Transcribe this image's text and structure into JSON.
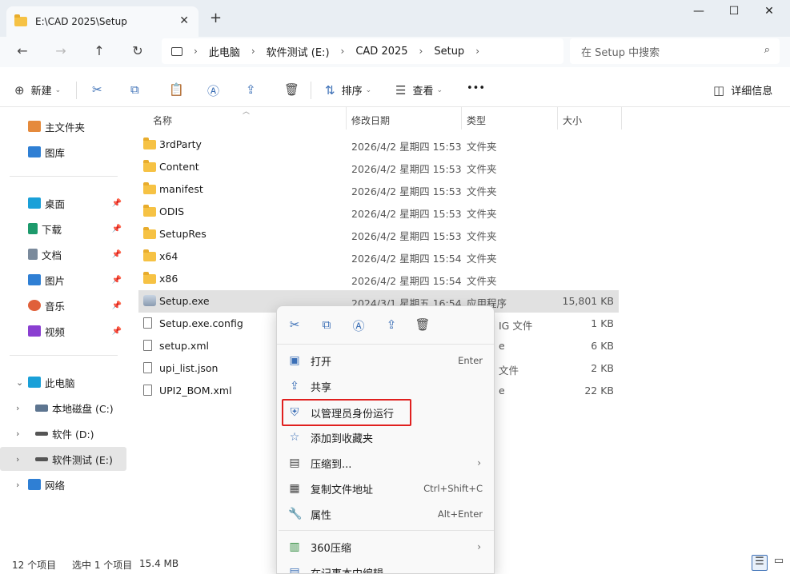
{
  "window": {
    "tab_title": "E:\\CAD 2025\\Setup",
    "tab_close": "✕",
    "tab_add": "+",
    "minimize": "—",
    "maximize": "☐",
    "close": "✕"
  },
  "nav": {
    "back": "←",
    "forward": "→",
    "up": "↑",
    "refresh": "↻",
    "breadcrumbs": [
      "此电脑",
      "软件测试 (E:)",
      "CAD 2025",
      "Setup"
    ],
    "sep": "›",
    "search_placeholder": "在 Setup 中搜索",
    "search_icon": "⌕"
  },
  "toolbar": {
    "new_label": "新建",
    "sort_label": "排序",
    "view_label": "查看",
    "more_label": "•••",
    "details_label": "详细信息",
    "icons": {
      "new": "⊕",
      "cut": "✂",
      "copy": "⧉",
      "paste": "📋",
      "rename": "Ⓐ",
      "share": "⇪",
      "delete": "🗑",
      "sort": "⇅",
      "view": "☰",
      "details": "◫"
    }
  },
  "sidebar": {
    "items": [
      {
        "label": "主文件夹",
        "icon": "home-icon"
      },
      {
        "label": "图库",
        "icon": "gallery-icon"
      },
      {
        "label": "桌面",
        "icon": "desktop-icon"
      },
      {
        "label": "下载",
        "icon": "download-icon"
      },
      {
        "label": "文档",
        "icon": "documents-icon"
      },
      {
        "label": "图片",
        "icon": "pictures-icon"
      },
      {
        "label": "音乐",
        "icon": "music-icon"
      },
      {
        "label": "视频",
        "icon": "videos-icon"
      },
      {
        "label": "此电脑",
        "icon": "pc-icon"
      },
      {
        "label": "本地磁盘 (C:)",
        "icon": "drive-icon"
      },
      {
        "label": "软件 (D:)",
        "icon": "drive-icon"
      },
      {
        "label": "软件测试 (E:)",
        "icon": "drive-icon"
      },
      {
        "label": "网络",
        "icon": "network-icon"
      }
    ],
    "pin": "📌"
  },
  "columns": {
    "name": "名称",
    "date": "修改日期",
    "type": "类型",
    "size": "大小"
  },
  "files": [
    {
      "name": "3rdParty",
      "date": "2026/4/2 星期四 15:53",
      "type": "文件夹",
      "size": "",
      "kind": "folder"
    },
    {
      "name": "Content",
      "date": "2026/4/2 星期四 15:53",
      "type": "文件夹",
      "size": "",
      "kind": "folder"
    },
    {
      "name": "manifest",
      "date": "2026/4/2 星期四 15:53",
      "type": "文件夹",
      "size": "",
      "kind": "folder"
    },
    {
      "name": "ODIS",
      "date": "2026/4/2 星期四 15:53",
      "type": "文件夹",
      "size": "",
      "kind": "folder"
    },
    {
      "name": "SetupRes",
      "date": "2026/4/2 星期四 15:53",
      "type": "文件夹",
      "size": "",
      "kind": "folder"
    },
    {
      "name": "x64",
      "date": "2026/4/2 星期四 15:54",
      "type": "文件夹",
      "size": "",
      "kind": "folder"
    },
    {
      "name": "x86",
      "date": "2026/4/2 星期四 15:54",
      "type": "文件夹",
      "size": "",
      "kind": "folder"
    },
    {
      "name": "Setup.exe",
      "date": "2024/3/1 星期五 16:54",
      "type": "应用程序",
      "size": "15,801 KB",
      "kind": "exe"
    },
    {
      "name": "Setup.exe.config",
      "date": "",
      "type": "IG 文件",
      "size": "1 KB",
      "kind": "file"
    },
    {
      "name": "setup.xml",
      "date": "",
      "type": "e",
      "size": "6 KB",
      "kind": "file"
    },
    {
      "name": "upi_list.json",
      "date": "",
      "type": "文件",
      "size": "2 KB",
      "kind": "file"
    },
    {
      "name": "UPI2_BOM.xml",
      "date": "",
      "type": "e",
      "size": "22 KB",
      "kind": "file"
    }
  ],
  "status": {
    "count": "12 个项目",
    "selected": "选中 1 个项目",
    "size": "15.4 MB"
  },
  "context_menu": {
    "quick_icons": {
      "cut": "✂",
      "copy": "⧉",
      "rename": "Ⓐ",
      "share": "⇪",
      "delete": "🗑"
    },
    "items": [
      {
        "label": "打开",
        "shortcut": "Enter",
        "icon": "▣"
      },
      {
        "label": "共享",
        "shortcut": "",
        "icon": "⇪"
      },
      {
        "label": "以管理员身份运行",
        "shortcut": "",
        "icon": "⛨"
      },
      {
        "label": "添加到收藏夹",
        "shortcut": "",
        "icon": "☆"
      },
      {
        "label": "压缩到...",
        "shortcut": "",
        "icon": "▤",
        "submenu": "›"
      },
      {
        "label": "复制文件地址",
        "shortcut": "Ctrl+Shift+C",
        "icon": "▦"
      },
      {
        "label": "属性",
        "shortcut": "Alt+Enter",
        "icon": "🔧"
      },
      {
        "label": "360压缩",
        "shortcut": "",
        "icon": "▥",
        "submenu": "›"
      },
      {
        "label": "在记事本中编辑",
        "shortcut": "",
        "icon": "▤"
      }
    ]
  },
  "colors": {
    "accent": "#3b6fb6",
    "highlight": "#e0201f",
    "folder": "#f6c244"
  }
}
